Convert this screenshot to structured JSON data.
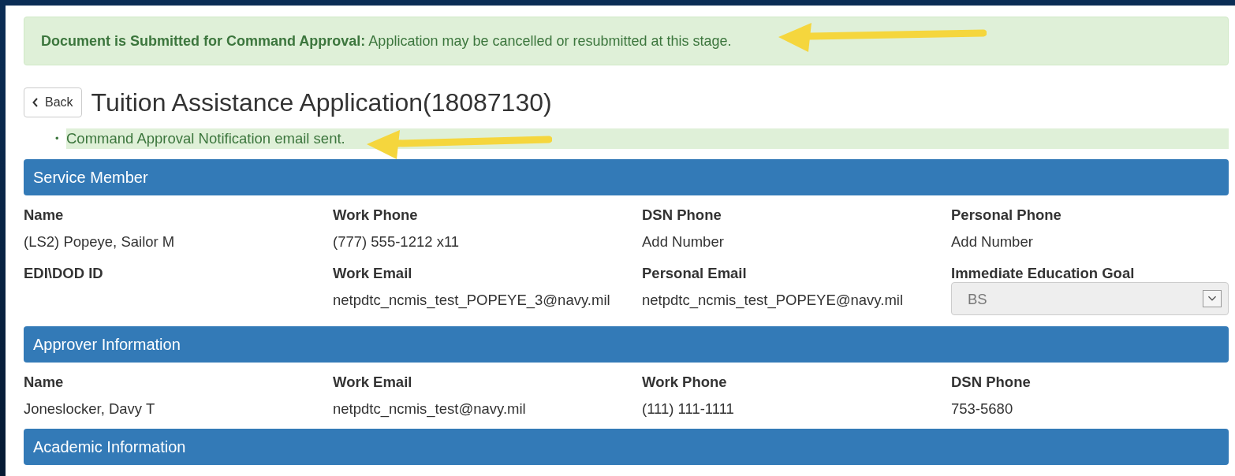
{
  "alert": {
    "title": "Document is Submitted for Command Approval:",
    "text": "Application may be cancelled or resubmitted at this stage."
  },
  "back_button": {
    "label": "Back"
  },
  "page_title": "Tuition Assistance Application(18087130)",
  "notifications": [
    {
      "bullet": "•",
      "text": "Command Approval Notification email sent."
    }
  ],
  "sections": [
    {
      "title": "Service Member",
      "fields": [
        {
          "kind": "text",
          "label": "Name",
          "value": "(LS2) Popeye, Sailor M"
        },
        {
          "kind": "text",
          "label": "Work Phone",
          "value": "(777) 555-1212 x11"
        },
        {
          "kind": "text",
          "label": "DSN Phone",
          "value": "Add Number"
        },
        {
          "kind": "text",
          "label": "Personal Phone",
          "value": "Add Number"
        },
        {
          "kind": "text",
          "label": "EDI\\DOD ID"
        },
        {
          "kind": "text",
          "label": "Work Email",
          "value": "netpdtc_ncmis_test_POPEYE_3@navy.mil"
        },
        {
          "kind": "text",
          "label": "Personal Email",
          "value": "netpdtc_ncmis_test_POPEYE@navy.mil"
        },
        {
          "kind": "select",
          "label": "Immediate Education Goal",
          "value": "BS",
          "disabled": true
        }
      ]
    },
    {
      "title": "Approver Information",
      "fields": [
        {
          "kind": "text",
          "label": "Name",
          "value": "Joneslocker, Davy T"
        },
        {
          "kind": "text",
          "label": "Work Email",
          "value": "netpdtc_ncmis_test@navy.mil"
        },
        {
          "kind": "text",
          "label": "Work Phone",
          "value": "(111) 111-1111"
        },
        {
          "kind": "text",
          "label": "DSN Phone",
          "value": "753-5680"
        }
      ]
    },
    {
      "title": "Academic Information"
    }
  ]
}
